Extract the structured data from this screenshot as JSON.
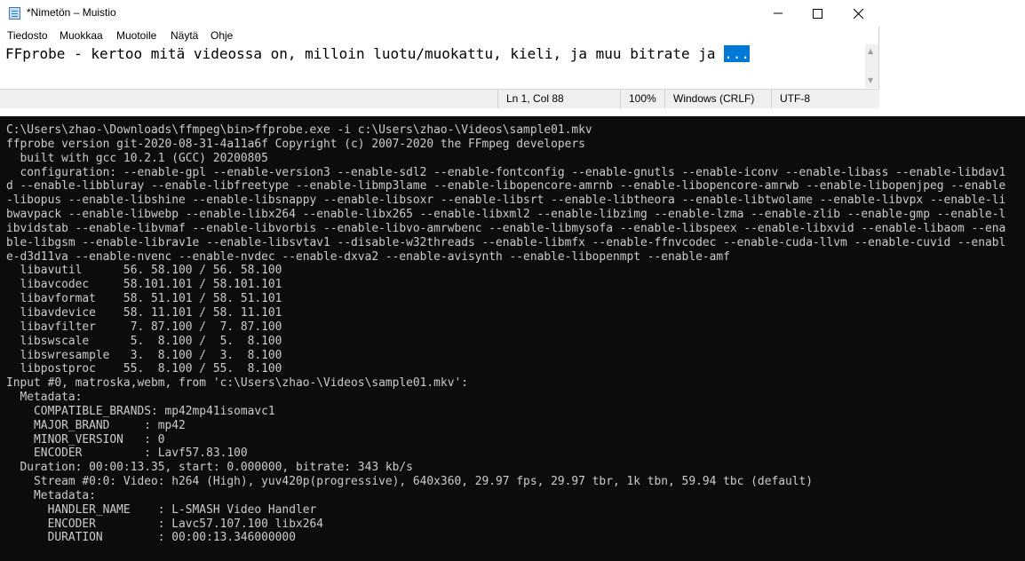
{
  "notepad": {
    "title": "*Nimetön – Muistio",
    "menu": [
      "Tiedosto",
      "Muokkaa",
      "Muotoile",
      "Näytä",
      "Ohje"
    ],
    "editor_text": "FFprobe - kertoo mitä videossa on, milloin luotu/muokattu, kieli, ja muu bitrate ja ",
    "editor_selected": "...",
    "status": {
      "position": "Ln 1, Col 88",
      "zoom": "100%",
      "line_ending": "Windows (CRLF)",
      "encoding": "UTF-8"
    },
    "controls": {
      "minimize_icon": "minimize-icon",
      "maximize_icon": "maximize-icon",
      "close_icon": "close-icon"
    }
  },
  "console": {
    "lines": [
      "C:\\Users\\zhao-\\Downloads\\ffmpeg\\bin>ffprobe.exe -i c:\\Users\\zhao-\\Videos\\sample01.mkv",
      "ffprobe version git-2020-08-31-4a11a6f Copyright (c) 2007-2020 the FFmpeg developers",
      "  built with gcc 10.2.1 (GCC) 20200805",
      "  configuration: --enable-gpl --enable-version3 --enable-sdl2 --enable-fontconfig --enable-gnutls --enable-iconv --enable-libass --enable-libdav1",
      "d --enable-libbluray --enable-libfreetype --enable-libmp3lame --enable-libopencore-amrnb --enable-libopencore-amrwb --enable-libopenjpeg --enable",
      "-libopus --enable-libshine --enable-libsnappy --enable-libsoxr --enable-libsrt --enable-libtheora --enable-libtwolame --enable-libvpx --enable-li",
      "bwavpack --enable-libwebp --enable-libx264 --enable-libx265 --enable-libxml2 --enable-libzimg --enable-lzma --enable-zlib --enable-gmp --enable-l",
      "ibvidstab --enable-libvmaf --enable-libvorbis --enable-libvo-amrwbenc --enable-libmysofa --enable-libspeex --enable-libxvid --enable-libaom --ena",
      "ble-libgsm --enable-librav1e --enable-libsvtav1 --disable-w32threads --enable-libmfx --enable-ffnvcodec --enable-cuda-llvm --enable-cuvid --enabl",
      "e-d3d11va --enable-nvenc --enable-nvdec --enable-dxva2 --enable-avisynth --enable-libopenmpt --enable-amf",
      "  libavutil      56. 58.100 / 56. 58.100",
      "  libavcodec     58.101.101 / 58.101.101",
      "  libavformat    58. 51.101 / 58. 51.101",
      "  libavdevice    58. 11.101 / 58. 11.101",
      "  libavfilter     7. 87.100 /  7. 87.100",
      "  libswscale      5.  8.100 /  5.  8.100",
      "  libswresample   3.  8.100 /  3.  8.100",
      "  libpostproc    55.  8.100 / 55.  8.100",
      "Input #0, matroska,webm, from 'c:\\Users\\zhao-\\Videos\\sample01.mkv':",
      "  Metadata:",
      "    COMPATIBLE_BRANDS: mp42mp41isomavc1",
      "    MAJOR_BRAND     : mp42",
      "    MINOR_VERSION   : 0",
      "    ENCODER         : Lavf57.83.100",
      "  Duration: 00:00:13.35, start: 0.000000, bitrate: 343 kb/s",
      "    Stream #0:0: Video: h264 (High), yuv420p(progressive), 640x360, 29.97 fps, 29.97 tbr, 1k tbn, 59.94 tbc (default)",
      "    Metadata:",
      "      HANDLER_NAME    : L-SMASH Video Handler",
      "      ENCODER         : Lavc57.107.100 libx264",
      "      DURATION        : 00:00:13.346000000"
    ]
  }
}
